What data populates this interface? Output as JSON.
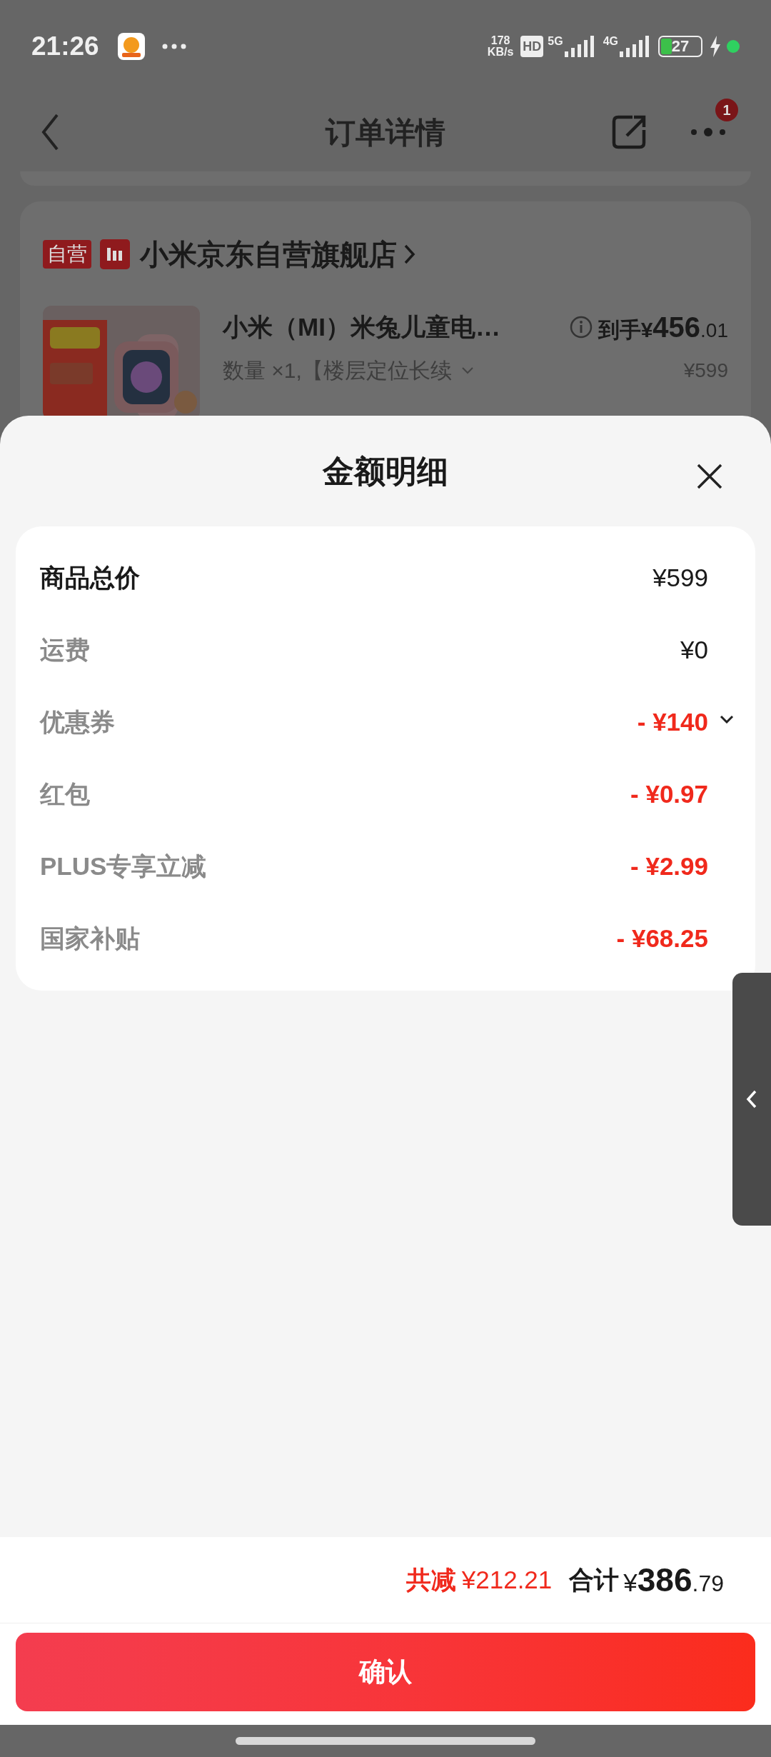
{
  "status_bar": {
    "time": "21:26",
    "network_speed": [
      "178",
      "KB/s"
    ],
    "hd": "HD",
    "sim1": "5G",
    "sim2": "4G",
    "battery": "27"
  },
  "nav": {
    "title": "订单详情",
    "badge": "1"
  },
  "store": {
    "tag": "自营",
    "name": "小米京东自营旗舰店"
  },
  "product": {
    "title": "小米（MI）米兔儿童电…",
    "spec": "数量 ×1,【楼层定位长续",
    "price_label": "到手",
    "price": "¥456",
    "price_decimal": ".01",
    "original_price": "¥599"
  },
  "sheet": {
    "title": "金额明细",
    "rows": [
      {
        "label": "商品总价",
        "value": "¥599",
        "kind": "total",
        "expandable": false
      },
      {
        "label": "运费",
        "value": "¥0",
        "kind": "fee",
        "expandable": false
      },
      {
        "label": "优惠券",
        "value": "- ¥140",
        "kind": "discount",
        "expandable": true
      },
      {
        "label": "红包",
        "value": "- ¥0.97",
        "kind": "discount",
        "expandable": false
      },
      {
        "label": "PLUS专享立减",
        "value": "- ¥2.99",
        "kind": "discount",
        "expandable": false
      },
      {
        "label": "国家补贴",
        "value": "- ¥68.25",
        "kind": "discount",
        "expandable": false
      }
    ]
  },
  "summary": {
    "discount_label": "共减",
    "discount": "¥212.21",
    "total_label": "合计",
    "total": "¥386",
    "total_decimal": ".79"
  },
  "confirm_button": "确认"
}
